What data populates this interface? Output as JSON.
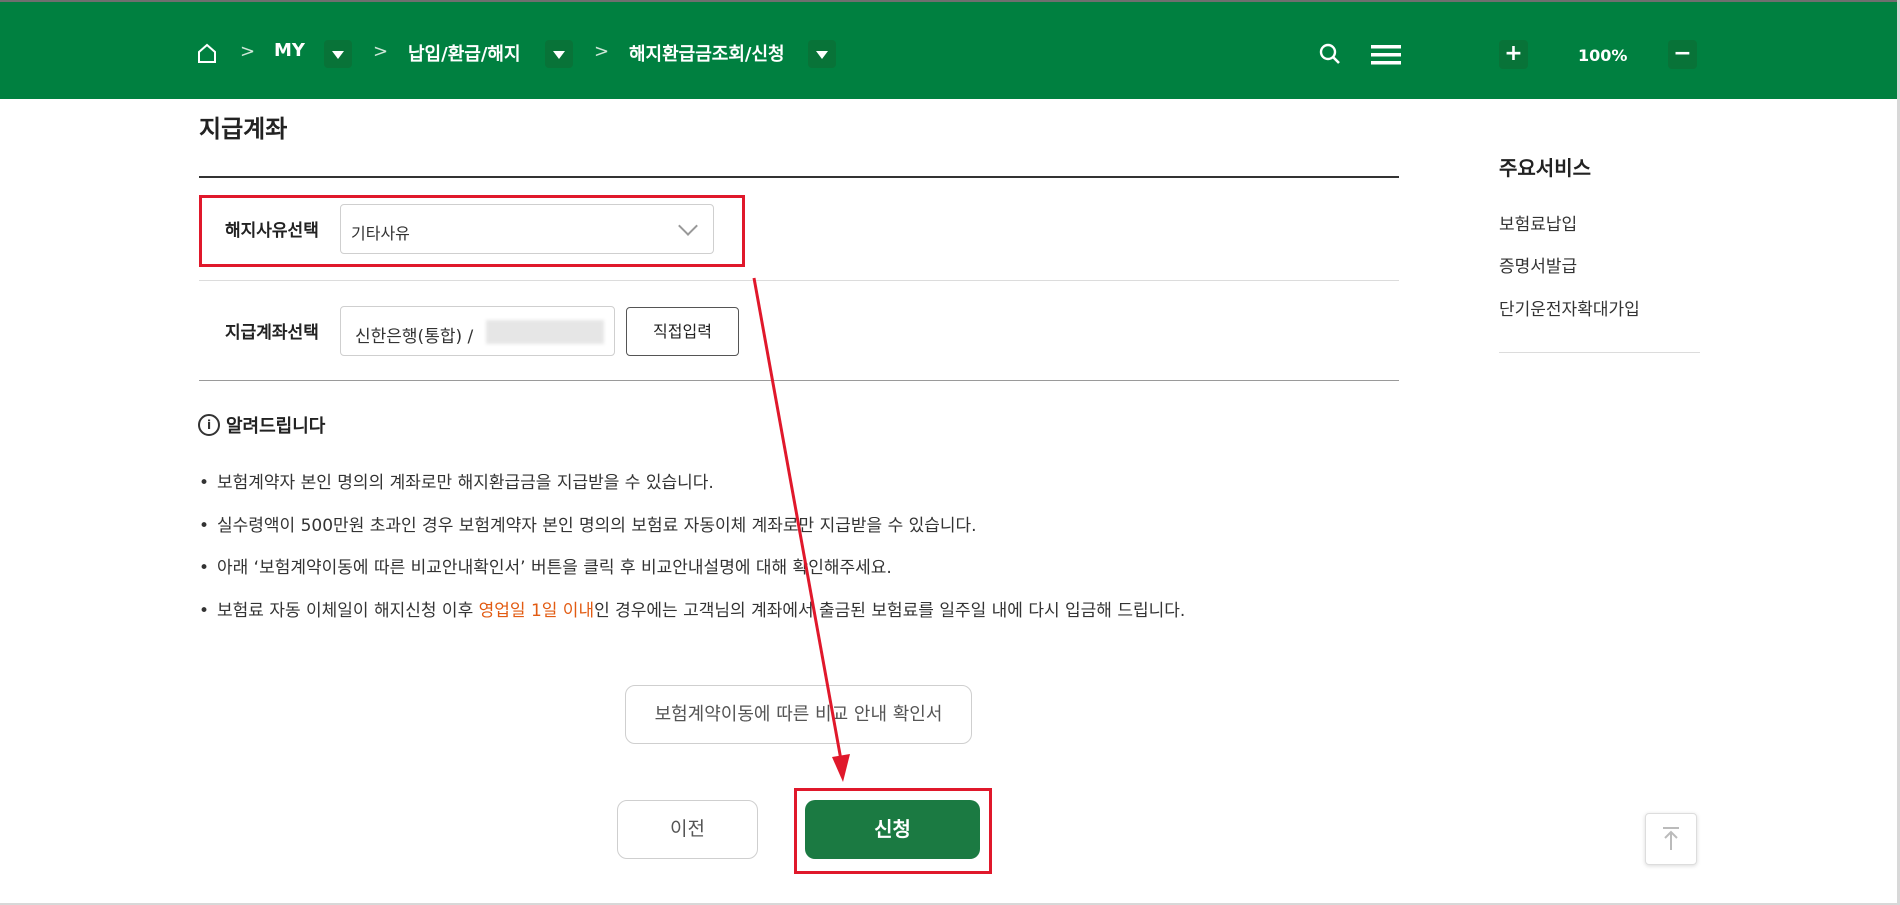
{
  "breadcrumb": {
    "home_icon": "home-icon",
    "items": [
      "MY",
      "납입/환급/해지",
      "해지환급금조회/신청"
    ],
    "separator": ">"
  },
  "header_tools": {
    "search_icon": "search-icon",
    "menu_icon": "hamburger-menu-icon",
    "zoom_in": "+",
    "zoom_level": "100%",
    "zoom_out": "−"
  },
  "section": {
    "title": "지급계좌"
  },
  "form": {
    "reason_label": "해지사유선택",
    "reason_value": "기타사유",
    "account_label": "지급계좌선택",
    "account_value": "신한은행(통합) /",
    "direct_input_label": "직접입력"
  },
  "notice": {
    "title": "알려드립니다",
    "bullets": [
      {
        "text": "보험계약자 본인 명의의 계좌로만 해지환급금을 지급받을 수 있습니다."
      },
      {
        "text": "실수령액이 500만원 초과인 경우 보험계약자 본인 명의의 보험료 자동이체 계좌로만 지급받을 수 있습니다."
      },
      {
        "text": "아래 ‘보험계약이동에 따른 비교안내확인서’ 버튼을 클릭 후 비교안내설명에 대해 확인해주세요."
      },
      {
        "pre": "보험료 자동 이체일이 해지신청 이후 ",
        "highlight": "영업일 1일 이내",
        "post": "인 경우에는 고객님의 계좌에서 출금된 보험료를 일주일 내에 다시 입금해 드립니다."
      }
    ]
  },
  "buttons": {
    "compare": "보험계약이동에 따른 비교 안내 확인서",
    "prev": "이전",
    "submit": "신청"
  },
  "sidebar": {
    "title": "주요서비스",
    "items": [
      "보험료납입",
      "증명서발급",
      "단기운전자확대가입"
    ]
  },
  "colors": {
    "header_green": "#008040",
    "primary_green": "#1b7a42",
    "highlight_orange": "#e25b12",
    "annotation_red": "#e0182b"
  }
}
